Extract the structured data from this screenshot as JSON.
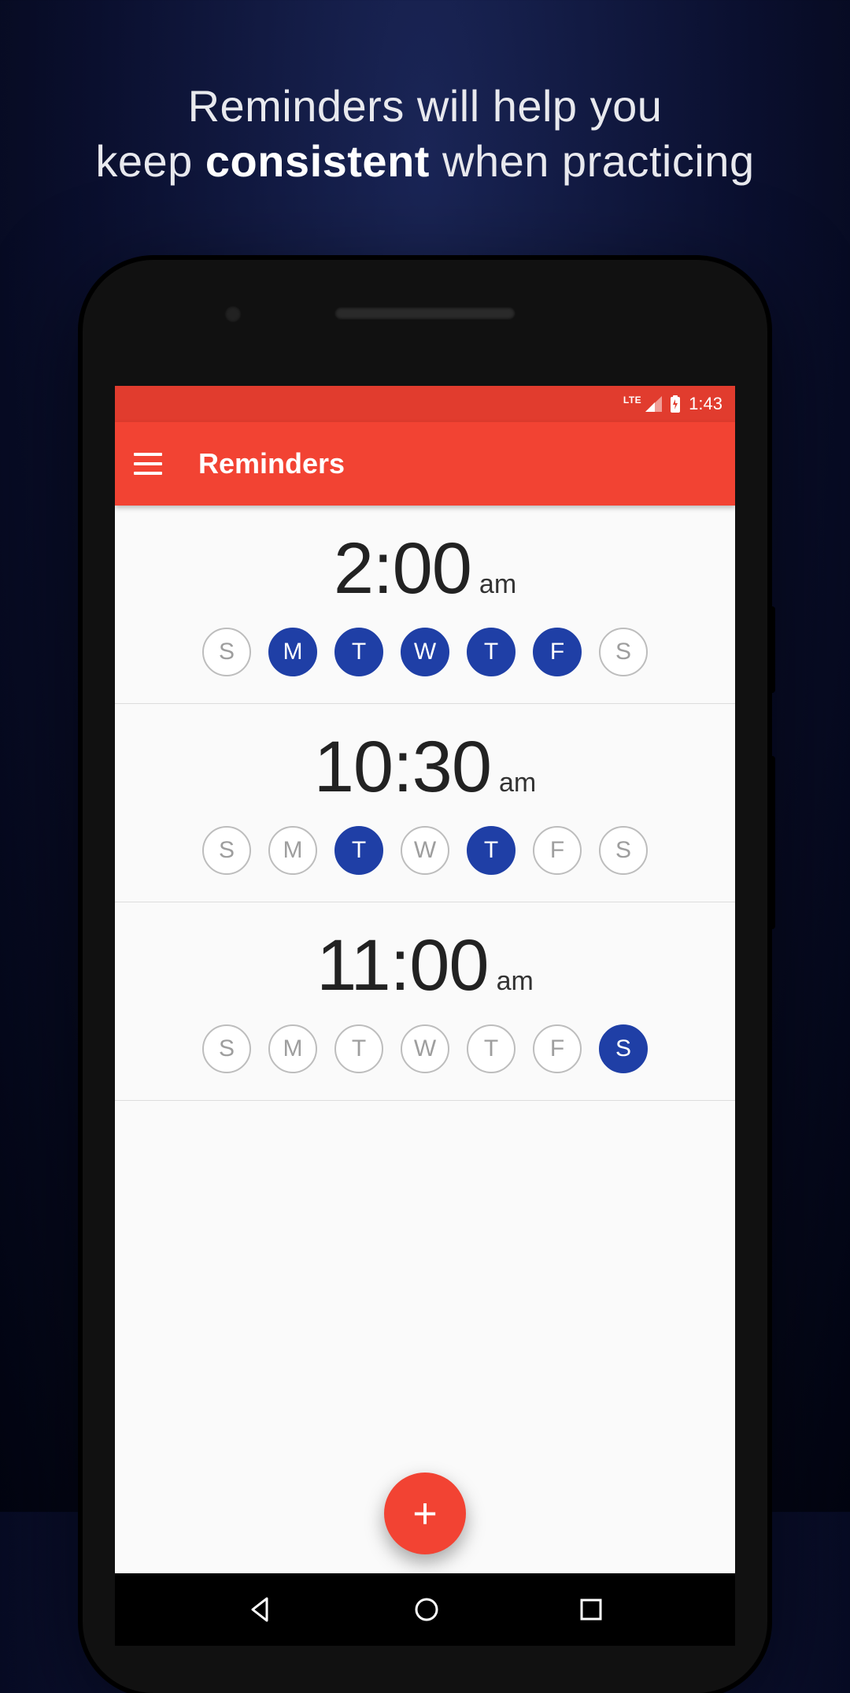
{
  "promo": {
    "line1": "Reminders will help you",
    "line2_pre": "keep ",
    "line2_strong": "consistent",
    "line2_post": " when practicing"
  },
  "statusbar": {
    "network": "LTE",
    "time": "1:43"
  },
  "appbar": {
    "title": "Reminders"
  },
  "day_labels": [
    "S",
    "M",
    "T",
    "W",
    "T",
    "F",
    "S"
  ],
  "reminders": [
    {
      "time": "2:00",
      "ampm": "am",
      "active_days": [
        false,
        true,
        true,
        true,
        true,
        true,
        false
      ]
    },
    {
      "time": "10:30",
      "ampm": "am",
      "active_days": [
        false,
        false,
        true,
        false,
        true,
        false,
        false
      ]
    },
    {
      "time": "11:00",
      "ampm": "am",
      "active_days": [
        false,
        false,
        false,
        false,
        false,
        false,
        true
      ]
    }
  ],
  "fab": {
    "label": "+"
  },
  "colors": {
    "accent": "#f24333",
    "accent_dark": "#e13c2e",
    "day_active": "#1f3fa6"
  }
}
